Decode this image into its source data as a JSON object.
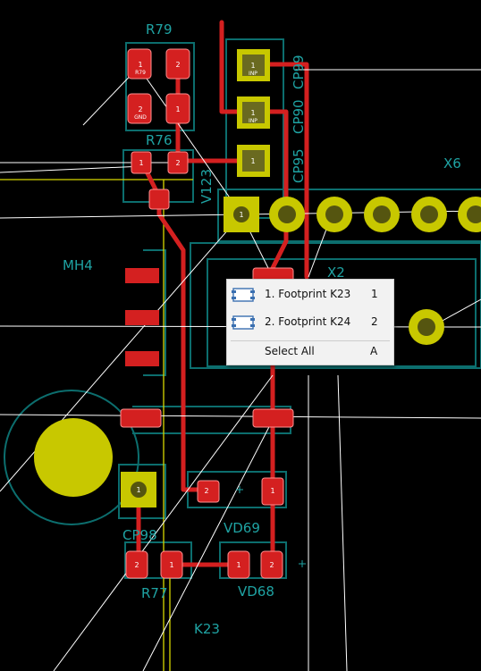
{
  "board": {
    "labels": {
      "r79": "R79",
      "r76": "R76",
      "mh4": "MH4",
      "x6": "X6",
      "x2": "X2",
      "cp98": "CP98",
      "r77": "R77",
      "vd69": "VD69",
      "vd68": "VD68",
      "k23": "K23",
      "cp99": "CP99",
      "cp90": "CP90",
      "cp95": "CP95",
      "v123": "V123"
    },
    "pad_numbers": {
      "one": "1",
      "two": "2"
    },
    "pad_nets": {
      "r79_1": "R79",
      "gnd": "GND",
      "inp_a": "INP",
      "inp_b": "INP",
      "inp_c": "INP"
    },
    "colors": {
      "background": "#000000",
      "copper": "#d42020",
      "pad_yellow": "#c8c800",
      "silk": "#1fa3a3",
      "ratsnest": "#ffffff",
      "courtyard": "#0c6e6e",
      "edge": "#d8d800"
    }
  },
  "context_menu": {
    "items": [
      {
        "label": "1. Footprint K23",
        "shortcut": "1",
        "icon": "footprint-icon"
      },
      {
        "label": "2. Footprint K24",
        "shortcut": "2",
        "icon": "footprint-icon"
      }
    ],
    "select_all": {
      "label": "Select All",
      "shortcut": "A"
    }
  }
}
